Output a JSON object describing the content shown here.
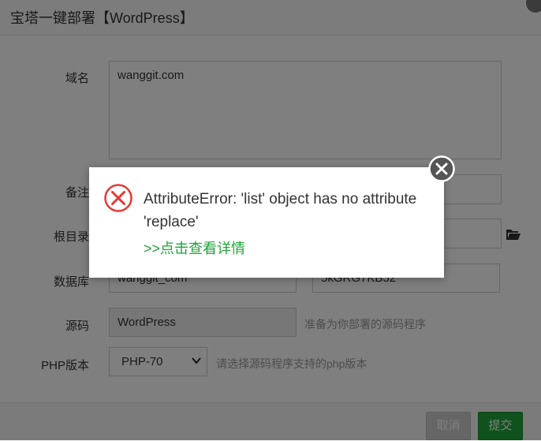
{
  "dialog": {
    "title": "宝塔一键部署【WordPress】"
  },
  "form": {
    "domain": {
      "label": "域名",
      "value": "wanggit.com"
    },
    "remark": {
      "label": "备注"
    },
    "root": {
      "label": "根目录"
    },
    "database": {
      "label": "数据库",
      "name_value": "wanggit_com",
      "password_value": "5kGRG7KB52"
    },
    "source": {
      "label": "源码",
      "value": "WordPress",
      "hint": "准备为你部署的源码程序"
    },
    "php": {
      "label": "PHP版本",
      "selected": "PHP-70",
      "hint": "请选择源码程序支持的php版本"
    }
  },
  "footer": {
    "cancel_label": "取消",
    "submit_label": "提交"
  },
  "error": {
    "message": "AttributeError: 'list' object has no attribute 'replace'",
    "link": ">>点击查看详情"
  },
  "colors": {
    "accent": "#20a53a",
    "error": "#e53935"
  },
  "icons": {
    "error": "error-circle-x-icon",
    "close": "close-circle-icon",
    "folder": "folder-open-icon",
    "select": "chevron-down-icon"
  }
}
